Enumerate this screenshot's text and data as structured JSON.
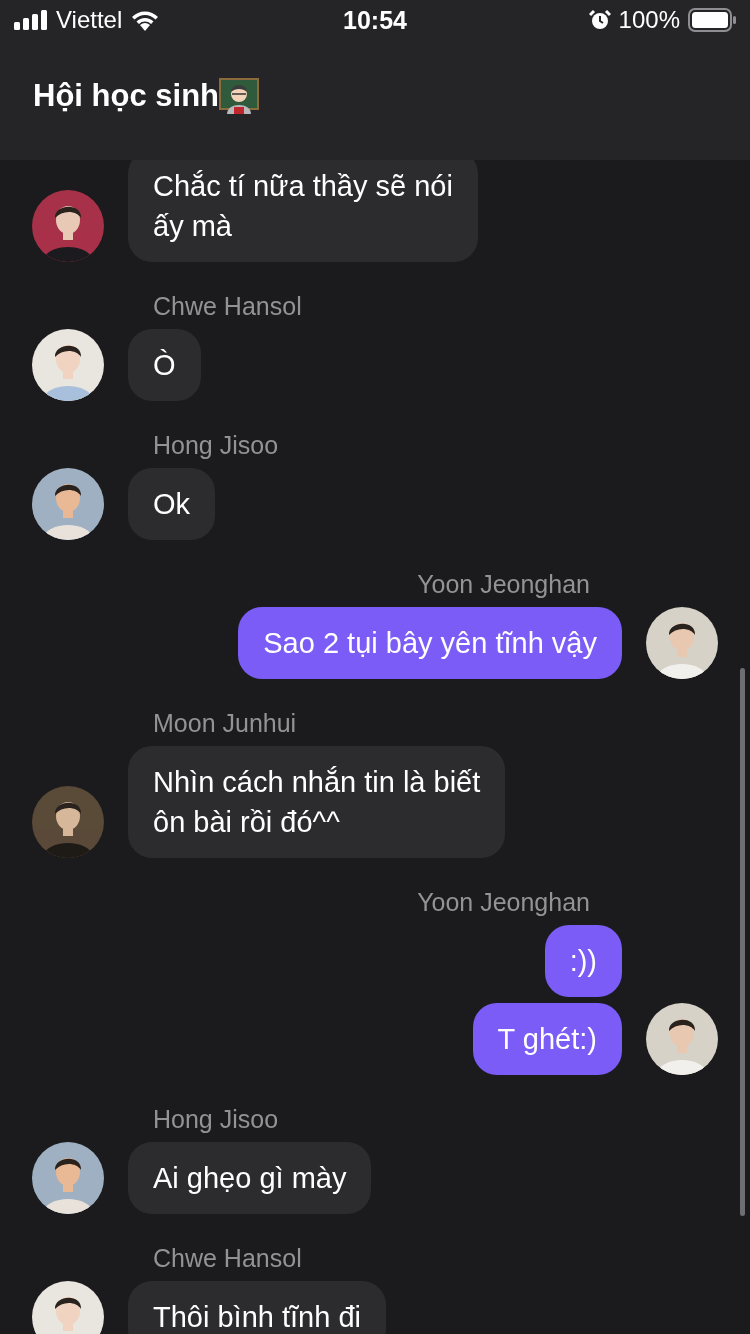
{
  "status_bar": {
    "carrier": "Viettel",
    "time": "10:54",
    "battery": "100%"
  },
  "header": {
    "title": "Hội học sinh"
  },
  "groups": [
    {
      "kind": "incoming",
      "bubbles": [
        "Chắc tí nữa thầy sẽ nói\nấy mà"
      ]
    },
    {
      "kind": "incoming",
      "sender": "Chwe Hansol",
      "bubbles": [
        "Ò"
      ]
    },
    {
      "kind": "incoming",
      "sender": "Hong Jisoo",
      "bubbles": [
        "Ok"
      ]
    },
    {
      "kind": "outgoing",
      "sender": "Yoon Jeonghan",
      "bubbles": [
        "Sao 2 tụi bây yên tĩnh vậy"
      ]
    },
    {
      "kind": "incoming",
      "sender": "Moon Junhui",
      "bubbles": [
        "Nhìn cách nhắn tin là biết\nôn bài rồi đó^^"
      ]
    },
    {
      "kind": "outgoing",
      "sender": "Yoon Jeonghan",
      "bubbles": [
        ":))",
        "T ghét:)"
      ]
    },
    {
      "kind": "incoming",
      "sender": "Hong Jisoo",
      "bubbles": [
        "Ai ghẹo gì mày"
      ]
    },
    {
      "kind": "incoming",
      "sender": "Chwe Hansol",
      "bubbles": [
        "Thôi bình tĩnh đi"
      ]
    }
  ]
}
